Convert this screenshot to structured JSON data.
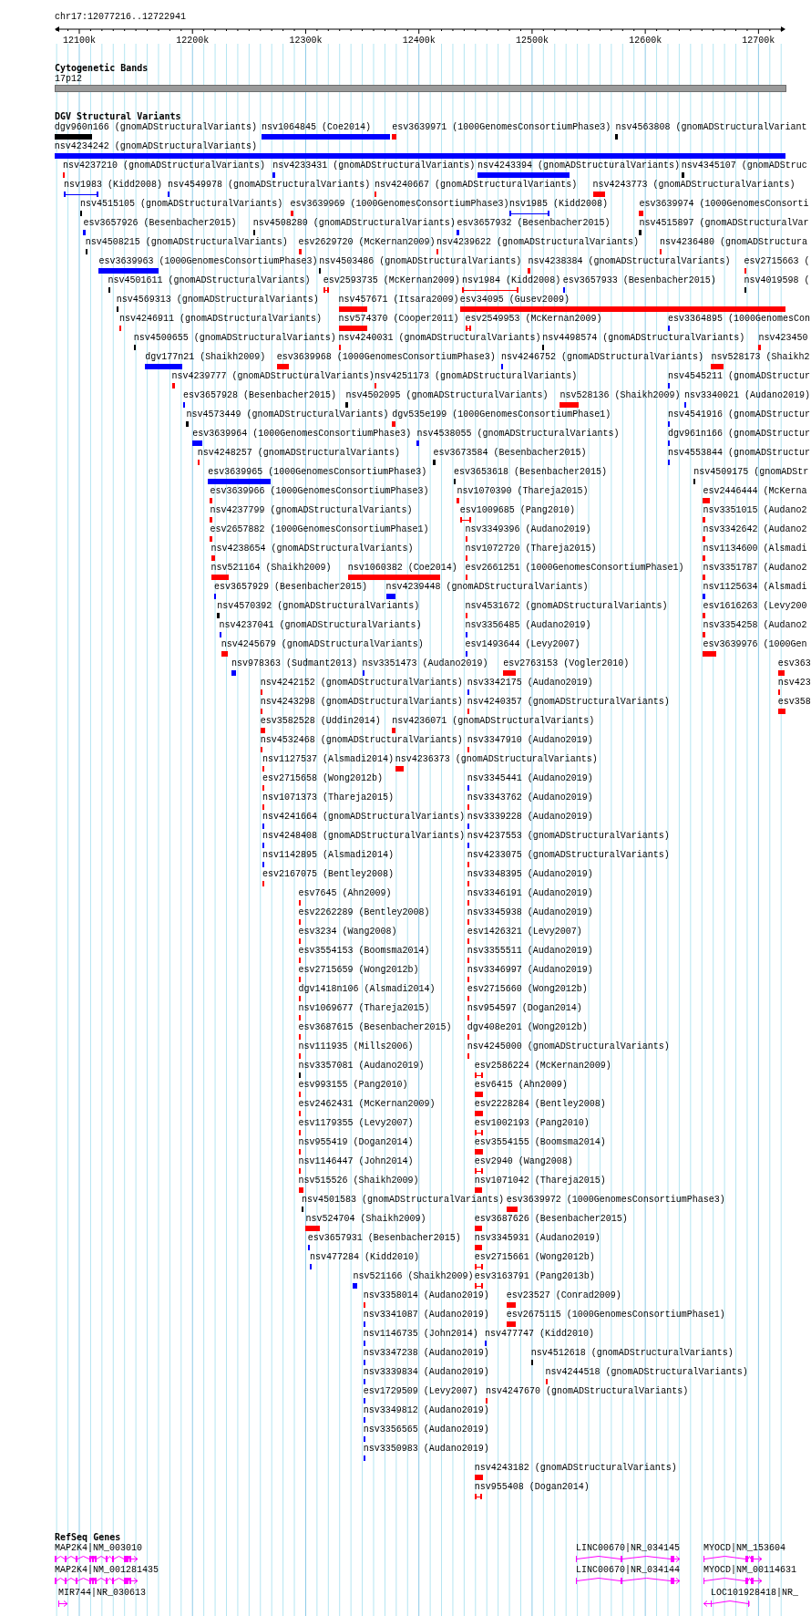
{
  "region": {
    "label": "chr17:12077216..12722941"
  },
  "ruler": {
    "ticks": [
      "12100k",
      "12200k",
      "12300k",
      "12400k",
      "12500k",
      "12600k",
      "12700k"
    ]
  },
  "cytoband": {
    "title": "Cytogenetic Bands",
    "band": "17p12"
  },
  "dgv": {
    "title": "DGV Structural Variants",
    "rows": [
      {
        "features": [
          {
            "label": "dgv960n166 (gnomADStructuralVariants)",
            "color": "#000000",
            "kind": "box"
          },
          {
            "label": "nsv1064845 (Coe2014)",
            "color": "#0000ff",
            "kind": "box"
          },
          {
            "label": "esv3639971 (1000GenomesConsortiumPhase3)",
            "color": "#ff0000",
            "kind": "box"
          },
          {
            "label": "nsv4563808 (gnomADStructuralVariant",
            "color": "#000000",
            "kind": "box"
          }
        ]
      },
      {
        "features": [
          {
            "label": "nsv4234242 (gnomADStructuralVariants)",
            "color": "#0000ff",
            "kind": "box"
          }
        ]
      },
      {
        "features": [
          {
            "label": "nsv4237210 (gnomADStructuralVariants)",
            "color": "#ff0000",
            "kind": "box"
          },
          {
            "label": "nsv4233431 (gnomADStructuralVariants)",
            "color": "#0000ff",
            "kind": "box"
          },
          {
            "label": "nsv4243394 (gnomADStructuralVariants)",
            "color": "#0000ff",
            "kind": "box"
          },
          {
            "label": "nsv4345107 (gnomADStruc",
            "color": "#000000",
            "kind": "box"
          }
        ]
      },
      {
        "features": [
          {
            "label": "nsv1983 (Kidd2008)",
            "color": "#0000ff",
            "kind": "span"
          },
          {
            "label": "nsv4549978 (gnomADStructuralVariants)",
            "color": "#0000ff",
            "kind": "box"
          },
          {
            "label": "nsv4240667 (gnomADStructuralVariants)",
            "color": "#ff0000",
            "kind": "box"
          },
          {
            "label": "nsv4243773 (gnomADStructuralVariants)",
            "color": "#ff0000",
            "kind": "box"
          }
        ]
      },
      {
        "features": [
          {
            "label": "nsv4515105 (gnomADStructuralVariants)",
            "color": "#000000",
            "kind": "box"
          },
          {
            "label": "esv3639969 (1000GenomesConsortiumPhase3)",
            "color": "#ff0000",
            "kind": "box"
          },
          {
            "label": "nsv1985 (Kidd2008)",
            "color": "#0000ff",
            "kind": "span"
          },
          {
            "label": "esv3639974 (1000GenomesConsorti",
            "color": "#ff0000",
            "kind": "box"
          }
        ]
      },
      {
        "features": [
          {
            "label": "esv3657926 (Besenbacher2015)",
            "color": "#0000ff",
            "kind": "box"
          },
          {
            "label": "nsv4508280 (gnomADStructuralVariants)",
            "color": "#000000",
            "kind": "box"
          },
          {
            "label": "esv3657932 (Besenbacher2015)",
            "color": "#0000ff",
            "kind": "box"
          },
          {
            "label": "nsv4515897 (gnomADStructuralVar",
            "color": "#000000",
            "kind": "box"
          }
        ]
      },
      {
        "features": [
          {
            "label": "nsv4508215 (gnomADStructuralVariants)",
            "color": "#000000",
            "kind": "box"
          },
          {
            "label": "esv2629720 (McKernan2009)",
            "color": "#ff0000",
            "kind": "box"
          },
          {
            "label": "nsv4239622 (gnomADStructuralVariants)",
            "color": "#ff0000",
            "kind": "box"
          },
          {
            "label": "nsv4236480 (gnomADStructura",
            "color": "#ff0000",
            "kind": "box"
          }
        ]
      },
      {
        "features": [
          {
            "label": "esv3639963 (1000GenomesConsortiumPhase3)",
            "color": "#0000ff",
            "kind": "box"
          },
          {
            "label": "nsv4503486 (gnomADStructuralVariants)",
            "color": "#000000",
            "kind": "box"
          },
          {
            "label": "nsv4238384 (gnomADStructuralVariants)",
            "color": "#ff0000",
            "kind": "box"
          },
          {
            "label": "esv2715663 (",
            "color": "#ff0000",
            "kind": "box"
          }
        ]
      },
      {
        "features": [
          {
            "label": "nsv4501611 (gnomADStructuralVariants)",
            "color": "#000000",
            "kind": "box"
          },
          {
            "label": "esv2593735 (McKernan2009)",
            "color": "#ff0000",
            "kind": "span"
          },
          {
            "label": "nsv1984 (Kidd2008)",
            "color": "#ff0000",
            "kind": "span"
          },
          {
            "label": "esv3657933 (Besenbacher2015)",
            "color": "#0000ff",
            "kind": "box"
          },
          {
            "label": "nsv4019598 (",
            "color": "#000000",
            "kind": "box"
          }
        ]
      },
      {
        "features": [
          {
            "label": "nsv4569313 (gnomADStructuralVariants)",
            "color": "#000000",
            "kind": "box"
          },
          {
            "label": "nsv457671 (Itsara2009)",
            "color": "#ff0000",
            "kind": "box"
          },
          {
            "label": "esv34095 (Gusev2009)",
            "color": "#ff0000",
            "kind": "box"
          }
        ]
      },
      {
        "features": [
          {
            "label": "nsv4246911 (gnomADStructuralVariants)",
            "color": "#ff0000",
            "kind": "box"
          },
          {
            "label": "nsv574370 (Cooper2011)",
            "color": "#ff0000",
            "kind": "box"
          },
          {
            "label": "esv2549953 (McKernan2009)",
            "color": "#ff0000",
            "kind": "span"
          },
          {
            "label": "esv3364895 (1000GenomesCon",
            "color": "#0000ff",
            "kind": "box"
          }
        ]
      },
      {
        "features": [
          {
            "label": "nsv4500655 (gnomADStructuralVariants)",
            "color": "#000000",
            "kind": "box"
          },
          {
            "label": "nsv4240031 (gnomADStructuralVariants)",
            "color": "#ff0000",
            "kind": "box"
          },
          {
            "label": "nsv4498574 (gnomADStructuralVariants)",
            "color": "#000000",
            "kind": "box"
          },
          {
            "label": "nsv423450",
            "color": "#ff0000",
            "kind": "box"
          }
        ]
      },
      {
        "features": [
          {
            "label": "dgv177n21 (Shaikh2009)",
            "color": "#0000ff",
            "kind": "box"
          },
          {
            "label": "esv3639968 (1000GenomesConsortiumPhase3)",
            "color": "#ff0000",
            "kind": "box"
          },
          {
            "label": "nsv4246752 (gnomADStructuralVariants)",
            "color": "#0000ff",
            "kind": "box"
          },
          {
            "label": "nsv528173 (Shaikh2",
            "color": "#ff0000",
            "kind": "box"
          }
        ]
      },
      {
        "features": [
          {
            "label": "nsv4239777 (gnomADStructuralVariants)",
            "color": "#ff0000",
            "kind": "box"
          },
          {
            "label": "nsv4251173 (gnomADStructuralVariants)",
            "color": "#ff0000",
            "kind": "box"
          },
          {
            "label": "nsv4545211 (gnomADStructur",
            "color": "#0000ff",
            "kind": "box"
          }
        ]
      },
      {
        "features": [
          {
            "label": "esv3657928 (Besenbacher2015)",
            "color": "#0000ff",
            "kind": "box"
          },
          {
            "label": "nsv4502095 (gnomADStructuralVariants)",
            "color": "#000000",
            "kind": "box"
          },
          {
            "label": "nsv528136 (Shaikh2009)",
            "color": "#ff0000",
            "kind": "box"
          },
          {
            "label": "nsv3340021 (Audano2019)",
            "color": "#0000ff",
            "kind": "box"
          }
        ]
      },
      {
        "features": [
          {
            "label": "nsv4573449 (gnomADStructuralVariants)",
            "color": "#000000",
            "kind": "box"
          },
          {
            "label": "dgv535e199 (1000GenomesConsortiumPhase1)",
            "color": "#ff0000",
            "kind": "box"
          },
          {
            "label": "nsv4541916 (gnomADStructur",
            "color": "#0000ff",
            "kind": "box"
          }
        ]
      },
      {
        "features": [
          {
            "label": "esv3639964 (1000GenomesConsortiumPhase3)",
            "color": "#0000ff",
            "kind": "box"
          },
          {
            "label": "nsv4538055 (gnomADStructuralVariants)",
            "color": "#0000ff",
            "kind": "box"
          },
          {
            "label": "dgv961n166 (gnomADStructur",
            "color": "#0000ff",
            "kind": "box"
          }
        ]
      },
      {
        "features": [
          {
            "label": "nsv4248257 (gnomADStructuralVariants)",
            "color": "#ff0000",
            "kind": "box"
          },
          {
            "label": "esv3673584 (Besenbacher2015)",
            "color": "#000000",
            "kind": "box"
          },
          {
            "label": "nsv4553844 (gnomADStructur",
            "color": "#0000ff",
            "kind": "box"
          }
        ]
      },
      {
        "features": [
          {
            "label": "esv3639965 (1000GenomesConsortiumPhase3)",
            "color": "#0000ff",
            "kind": "box"
          },
          {
            "label": "esv3653618 (Besenbacher2015)",
            "color": "#000000",
            "kind": "box"
          },
          {
            "label": "nsv4509175 (gnomADStr",
            "color": "#000000",
            "kind": "box"
          }
        ]
      },
      {
        "features": [
          {
            "label": "esv3639966 (1000GenomesConsortiumPhase3)",
            "color": "#ff0000",
            "kind": "box"
          },
          {
            "label": "nsv1070390 (Thareja2015)",
            "color": "#ff0000",
            "kind": "box"
          },
          {
            "label": "esv2446444 (McKerna",
            "color": "#ff0000",
            "kind": "box"
          }
        ]
      },
      {
        "features": [
          {
            "label": "nsv4237799 (gnomADStructuralVariants)",
            "color": "#ff0000",
            "kind": "box"
          },
          {
            "label": "esv1009685 (Pang2010)",
            "color": "#ff0000",
            "kind": "span"
          },
          {
            "label": "nsv3351015 (Audano2",
            "color": "#ff0000",
            "kind": "box"
          }
        ]
      },
      {
        "features": [
          {
            "label": "esv2657882 (1000GenomesConsortiumPhase1)",
            "color": "#ff0000",
            "kind": "box"
          },
          {
            "label": "nsv3349396 (Audano2019)",
            "color": "#ff0000",
            "kind": "box"
          },
          {
            "label": "nsv3342642 (Audano2",
            "color": "#ff0000",
            "kind": "box"
          }
        ]
      },
      {
        "features": [
          {
            "label": "nsv4238654 (gnomADStructuralVariants)",
            "color": "#ff0000",
            "kind": "box"
          },
          {
            "label": "nsv1072720 (Thareja2015)",
            "color": "#ff0000",
            "kind": "box"
          },
          {
            "label": "nsv1134600 (Alsmadi",
            "color": "#ff0000",
            "kind": "box"
          }
        ]
      },
      {
        "features": [
          {
            "label": "nsv521164 (Shaikh2009)",
            "color": "#ff0000",
            "kind": "box"
          },
          {
            "label": "nsv1060382 (Coe2014)",
            "color": "#ff0000",
            "kind": "box"
          },
          {
            "label": "esv2661251 (1000GenomesConsortiumPhase1)",
            "color": "#ff0000",
            "kind": "box"
          },
          {
            "label": "nsv3351787 (Audano2",
            "color": "#ff0000",
            "kind": "box"
          }
        ]
      },
      {
        "features": [
          {
            "label": "esv3657929 (Besenbacher2015)",
            "color": "#0000ff",
            "kind": "box"
          },
          {
            "label": "nsv4239448 (gnomADStructuralVariants)",
            "color": "#0000ff",
            "kind": "box"
          },
          {
            "label": "nsv1125634 (Alsmadi",
            "color": "#0000ff",
            "kind": "box"
          }
        ]
      },
      {
        "features": [
          {
            "label": "nsv4570392 (gnomADStructuralVariants)",
            "color": "#000000",
            "kind": "box"
          },
          {
            "label": "nsv4531672 (gnomADStructuralVariants)",
            "color": "#ff0000",
            "kind": "box"
          },
          {
            "label": "esv1616263 (Levy200",
            "color": "#ff0000",
            "kind": "box"
          }
        ]
      },
      {
        "features": [
          {
            "label": "nsv4237041 (gnomADStructuralVariants)",
            "color": "#0000ff",
            "kind": "box"
          },
          {
            "label": "nsv3356485 (Audano2019)",
            "color": "#0000ff",
            "kind": "box"
          },
          {
            "label": "nsv3354258 (Audano2",
            "color": "#ff0000",
            "kind": "box"
          }
        ]
      },
      {
        "features": [
          {
            "label": "nsv4245679 (gnomADStructuralVariants)",
            "color": "#ff0000",
            "kind": "box"
          },
          {
            "label": "esv1493644 (Levy2007)",
            "color": "#0000ff",
            "kind": "box"
          },
          {
            "label": "esv3639976 (1000Gen",
            "color": "#ff0000",
            "kind": "box"
          }
        ]
      },
      {
        "features": [
          {
            "label": "nsv978363 (Sudmant2013)",
            "color": "#0000ff",
            "kind": "box"
          },
          {
            "label": "nsv3351473 (Audano2019)",
            "color": "#0000ff",
            "kind": "box"
          },
          {
            "label": "esv2763153 (Vogler2010)",
            "color": "#ff0000",
            "kind": "box"
          },
          {
            "label": "esv363",
            "color": "#ff0000",
            "kind": "box"
          }
        ]
      },
      {
        "features": [
          {
            "label": "nsv4242152 (gnomADStructuralVariants)",
            "color": "#ff0000",
            "kind": "box"
          },
          {
            "label": "nsv3342175 (Audano2019)",
            "color": "#0000ff",
            "kind": "box"
          },
          {
            "label": "nsv423",
            "color": "#ff0000",
            "kind": "box"
          }
        ]
      },
      {
        "features": [
          {
            "label": "nsv4243298 (gnomADStructuralVariants)",
            "color": "#ff0000",
            "kind": "box"
          },
          {
            "label": "nsv4240357 (gnomADStructuralVariants)",
            "color": "#ff0000",
            "kind": "box"
          },
          {
            "label": "esv358",
            "color": "#ff0000",
            "kind": "box"
          }
        ]
      },
      {
        "features": [
          {
            "label": "esv3582528 (Uddin2014)",
            "color": "#ff0000",
            "kind": "box"
          },
          {
            "label": "nsv4236071 (gnomADStructuralVariants)",
            "color": "#ff0000",
            "kind": "box"
          }
        ]
      },
      {
        "features": [
          {
            "label": "nsv4532468 (gnomADStructuralVariants)",
            "color": "#ff0000",
            "kind": "box"
          },
          {
            "label": "nsv3347910 (Audano2019)",
            "color": "#ff0000",
            "kind": "box"
          }
        ]
      },
      {
        "features": [
          {
            "label": "nsv1127537 (Alsmadi2014)",
            "color": "#ff0000",
            "kind": "box"
          },
          {
            "label": "nsv4236373 (gnomADStructuralVariants)",
            "color": "#ff0000",
            "kind": "box"
          }
        ]
      },
      {
        "features": [
          {
            "label": "esv2715658 (Wong2012b)",
            "color": "#ff0000",
            "kind": "box"
          },
          {
            "label": "nsv3345441 (Audano2019)",
            "color": "#0000ff",
            "kind": "box"
          }
        ]
      },
      {
        "features": [
          {
            "label": "nsv1071373 (Thareja2015)",
            "color": "#ff0000",
            "kind": "box"
          },
          {
            "label": "nsv3343762 (Audano2019)",
            "color": "#ff0000",
            "kind": "box"
          }
        ]
      },
      {
        "features": [
          {
            "label": "nsv4241664 (gnomADStructuralVariants)",
            "color": "#0000ff",
            "kind": "box"
          },
          {
            "label": "nsv3339228 (Audano2019)",
            "color": "#0000ff",
            "kind": "box"
          }
        ]
      },
      {
        "features": [
          {
            "label": "nsv4248408 (gnomADStructuralVariants)",
            "color": "#0000ff",
            "kind": "box"
          },
          {
            "label": "nsv4237553 (gnomADStructuralVariants)",
            "color": "#0000ff",
            "kind": "box"
          }
        ]
      },
      {
        "features": [
          {
            "label": "nsv1142895 (Alsmadi2014)",
            "color": "#0000ff",
            "kind": "box"
          },
          {
            "label": "nsv4233075 (gnomADStructuralVariants)",
            "color": "#ff0000",
            "kind": "box"
          }
        ]
      },
      {
        "features": [
          {
            "label": "esv2167075 (Bentley2008)",
            "color": "#ff0000",
            "kind": "box"
          },
          {
            "label": "nsv3348395 (Audano2019)",
            "color": "#ff0000",
            "kind": "box"
          }
        ]
      },
      {
        "features": [
          {
            "label": "esv7645 (Ahn2009)",
            "color": "#ff0000",
            "kind": "box"
          },
          {
            "label": "nsv3346191 (Audano2019)",
            "color": "#ff0000",
            "kind": "box"
          }
        ]
      },
      {
        "features": [
          {
            "label": "esv2262289 (Bentley2008)",
            "color": "#ff0000",
            "kind": "box"
          },
          {
            "label": "nsv3345938 (Audano2019)",
            "color": "#ff0000",
            "kind": "box"
          }
        ]
      },
      {
        "features": [
          {
            "label": "esv3234 (Wang2008)",
            "color": "#ff0000",
            "kind": "box"
          },
          {
            "label": "esv1426321 (Levy2007)",
            "color": "#ff0000",
            "kind": "box"
          }
        ]
      },
      {
        "features": [
          {
            "label": "esv3554153 (Boomsma2014)",
            "color": "#ff0000",
            "kind": "box"
          },
          {
            "label": "nsv3355511 (Audano2019)",
            "color": "#ff0000",
            "kind": "box"
          }
        ]
      },
      {
        "features": [
          {
            "label": "esv2715659 (Wong2012b)",
            "color": "#ff0000",
            "kind": "box"
          },
          {
            "label": "nsv3346997 (Audano2019)",
            "color": "#ff0000",
            "kind": "box"
          }
        ]
      },
      {
        "features": [
          {
            "label": "dgv1418n106 (Alsmadi2014)",
            "color": "#ff0000",
            "kind": "box"
          },
          {
            "label": "esv2715660 (Wong2012b)",
            "color": "#ff0000",
            "kind": "box"
          }
        ]
      },
      {
        "features": [
          {
            "label": "nsv1069677 (Thareja2015)",
            "color": "#ff0000",
            "kind": "box"
          },
          {
            "label": "nsv954597 (Dogan2014)",
            "color": "#ff0000",
            "kind": "box"
          }
        ]
      },
      {
        "features": [
          {
            "label": "esv3687615 (Besenbacher2015)",
            "color": "#ff0000",
            "kind": "box"
          },
          {
            "label": "dgv408e201 (Wong2012b)",
            "color": "#ff0000",
            "kind": "box"
          }
        ]
      },
      {
        "features": [
          {
            "label": "nsv111935 (Mills2006)",
            "color": "#ff0000",
            "kind": "box"
          },
          {
            "label": "nsv4245000 (gnomADStructuralVariants)",
            "color": "#ff0000",
            "kind": "box"
          }
        ]
      },
      {
        "features": [
          {
            "label": "nsv3357081 (Audano2019)",
            "color": "#000000",
            "kind": "box"
          },
          {
            "label": "esv2586224 (McKernan2009)",
            "color": "#ff0000",
            "kind": "span"
          }
        ]
      },
      {
        "features": [
          {
            "label": "esv993155 (Pang2010)",
            "color": "#ff0000",
            "kind": "box"
          },
          {
            "label": "esv6415 (Ahn2009)",
            "color": "#ff0000",
            "kind": "box"
          }
        ]
      },
      {
        "features": [
          {
            "label": "esv2462431 (McKernan2009)",
            "color": "#ff0000",
            "kind": "box"
          },
          {
            "label": "esv2228284 (Bentley2008)",
            "color": "#ff0000",
            "kind": "box"
          }
        ]
      },
      {
        "features": [
          {
            "label": "esv1179355 (Levy2007)",
            "color": "#ff0000",
            "kind": "box"
          },
          {
            "label": "esv1002193 (Pang2010)",
            "color": "#ff0000",
            "kind": "span"
          }
        ]
      },
      {
        "features": [
          {
            "label": "nsv955419 (Dogan2014)",
            "color": "#ff0000",
            "kind": "box"
          },
          {
            "label": "esv3554155 (Boomsma2014)",
            "color": "#ff0000",
            "kind": "box"
          }
        ]
      },
      {
        "features": [
          {
            "label": "nsv1146447 (John2014)",
            "color": "#ff0000",
            "kind": "box"
          },
          {
            "label": "esv2940 (Wang2008)",
            "color": "#ff0000",
            "kind": "span"
          }
        ]
      },
      {
        "features": [
          {
            "label": "nsv515526 (Shaikh2009)",
            "color": "#ff0000",
            "kind": "box"
          },
          {
            "label": "nsv1071042 (Thareja2015)",
            "color": "#ff0000",
            "kind": "box"
          }
        ]
      },
      {
        "features": [
          {
            "label": "nsv4501583 (gnomADStructuralVariants)",
            "color": "#000000",
            "kind": "box"
          },
          {
            "label": "esv3639972 (1000GenomesConsortiumPhase3)",
            "color": "#ff0000",
            "kind": "box"
          }
        ]
      },
      {
        "features": [
          {
            "label": "nsv524704 (Shaikh2009)",
            "color": "#ff0000",
            "kind": "box"
          },
          {
            "label": "esv3687626 (Besenbacher2015)",
            "color": "#ff0000",
            "kind": "box"
          }
        ]
      },
      {
        "features": [
          {
            "label": "esv3657931 (Besenbacher2015)",
            "color": "#0000ff",
            "kind": "box"
          },
          {
            "label": "nsv3345931 (Audano2019)",
            "color": "#ff0000",
            "kind": "box"
          }
        ]
      },
      {
        "features": [
          {
            "label": "nsv477284 (Kidd2010)",
            "color": "#0000ff",
            "kind": "box"
          },
          {
            "label": "esv2715661 (Wong2012b)",
            "color": "#ff0000",
            "kind": "span"
          }
        ]
      },
      {
        "features": [
          {
            "label": "nsv521166 (Shaikh2009)",
            "color": "#0000ff",
            "kind": "box"
          },
          {
            "label": "esv3163791 (Pang2013b)",
            "color": "#ff0000",
            "kind": "span"
          }
        ]
      },
      {
        "features": [
          {
            "label": "nsv3358014 (Audano2019)",
            "color": "#ff0000",
            "kind": "box"
          },
          {
            "label": "esv23527 (Conrad2009)",
            "color": "#ff0000",
            "kind": "box"
          }
        ]
      },
      {
        "features": [
          {
            "label": "nsv3341087 (Audano2019)",
            "color": "#0000ff",
            "kind": "box"
          },
          {
            "label": "esv2675115 (1000GenomesConsortiumPhase1)",
            "color": "#ff0000",
            "kind": "box"
          }
        ]
      },
      {
        "features": [
          {
            "label": "nsv1146735 (John2014)",
            "color": "#0000ff",
            "kind": "box"
          },
          {
            "label": "nsv477747 (Kidd2010)",
            "color": "#0000ff",
            "kind": "box"
          }
        ]
      },
      {
        "features": [
          {
            "label": "nsv3347238 (Audano2019)",
            "color": "#0000ff",
            "kind": "box"
          },
          {
            "label": "nsv4512618 (gnomADStructuralVariants)",
            "color": "#000000",
            "kind": "box"
          }
        ]
      },
      {
        "features": [
          {
            "label": "nsv3339834 (Audano2019)",
            "color": "#0000ff",
            "kind": "box"
          },
          {
            "label": "nsv4244518 (gnomADStructuralVariants)",
            "color": "#ff0000",
            "kind": "box"
          }
        ]
      },
      {
        "features": [
          {
            "label": "esv1729509 (Levy2007)",
            "color": "#0000ff",
            "kind": "box"
          },
          {
            "label": "nsv4247670 (gnomADStructuralVariants)",
            "color": "#ff0000",
            "kind": "box"
          }
        ]
      },
      {
        "features": [
          {
            "label": "nsv3349812 (Audano2019)",
            "color": "#0000ff",
            "kind": "box"
          }
        ]
      },
      {
        "features": [
          {
            "label": "nsv3356565 (Audano2019)",
            "color": "#0000ff",
            "kind": "box"
          }
        ]
      },
      {
        "features": [
          {
            "label": "nsv3350983 (Audano2019)",
            "color": "#0000ff",
            "kind": "box"
          }
        ]
      },
      {
        "features": [
          {
            "label": "nsv4243182 (gnomADStructuralVariants)",
            "color": "#ff0000",
            "kind": "box"
          }
        ]
      },
      {
        "features": [
          {
            "label": "nsv955408 (Dogan2014)",
            "color": "#ff0000",
            "kind": "span"
          }
        ]
      }
    ]
  },
  "refseq": {
    "title": "RefSeq Genes",
    "rows": [
      {
        "genes": [
          {
            "label": "MAP2K4|NM_003010"
          },
          {
            "label": "LINC00670|NR_034145"
          },
          {
            "label": "MYOCD|NM_153604"
          }
        ]
      },
      {
        "genes": [
          {
            "label": "MAP2K4|NM_001281435"
          },
          {
            "label": "LINC00670|NR_034144"
          },
          {
            "label": "MYOCD|NM_00114631"
          }
        ]
      },
      {
        "genes": [
          {
            "label": "MIR744|NR_030613"
          },
          {
            "label": "LOC101928418|NR_"
          }
        ]
      }
    ]
  }
}
